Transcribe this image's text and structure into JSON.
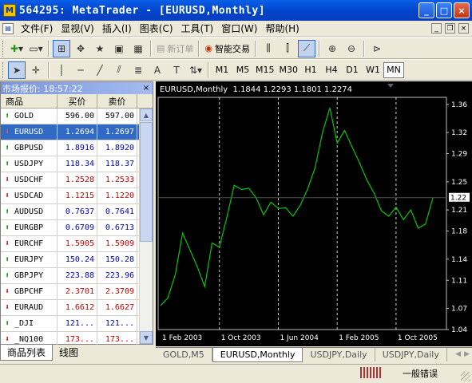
{
  "window": {
    "title": "564295: MetaTrader - [EURUSD,Monthly]"
  },
  "menu": {
    "items": [
      "文件(F)",
      "显视(V)",
      "插入(I)",
      "图表(C)",
      "工具(T)",
      "窗口(W)",
      "帮助(H)"
    ]
  },
  "toolbar": {
    "new_order_label": "新订单",
    "expert_label": "智能交易",
    "timeframes": [
      "M1",
      "M5",
      "M15",
      "M30",
      "H1",
      "H4",
      "D1",
      "W1",
      "MN"
    ],
    "active_timeframe": "MN"
  },
  "market_watch": {
    "header": "市场报价: 18:57:22",
    "columns": [
      "商品",
      "买价",
      "卖价"
    ],
    "rows": [
      {
        "symbol": "GOLD",
        "bid": "596.00",
        "ask": "597.00",
        "dir": "up",
        "color": "normal"
      },
      {
        "symbol": "EURUSD",
        "bid": "1.2694",
        "ask": "1.2697",
        "dir": "down",
        "color": "normal",
        "selected": true
      },
      {
        "symbol": "GBPUSD",
        "bid": "1.8916",
        "ask": "1.8920",
        "dir": "up",
        "color": "blue"
      },
      {
        "symbol": "USDJPY",
        "bid": "118.34",
        "ask": "118.37",
        "dir": "up",
        "color": "blue"
      },
      {
        "symbol": "USDCHF",
        "bid": "1.2528",
        "ask": "1.2533",
        "dir": "down",
        "color": "red"
      },
      {
        "symbol": "USDCAD",
        "bid": "1.1215",
        "ask": "1.1220",
        "dir": "down",
        "color": "red"
      },
      {
        "symbol": "AUDUSD",
        "bid": "0.7637",
        "ask": "0.7641",
        "dir": "up",
        "color": "blue"
      },
      {
        "symbol": "EURGBP",
        "bid": "0.6709",
        "ask": "0.6713",
        "dir": "up",
        "color": "blue"
      },
      {
        "symbol": "EURCHF",
        "bid": "1.5905",
        "ask": "1.5909",
        "dir": "down",
        "color": "red"
      },
      {
        "symbol": "EURJPY",
        "bid": "150.24",
        "ask": "150.28",
        "dir": "up",
        "color": "blue"
      },
      {
        "symbol": "GBPJPY",
        "bid": "223.88",
        "ask": "223.96",
        "dir": "up",
        "color": "blue"
      },
      {
        "symbol": "GBPCHF",
        "bid": "2.3701",
        "ask": "2.3709",
        "dir": "down",
        "color": "red"
      },
      {
        "symbol": "EURAUD",
        "bid": "1.6612",
        "ask": "1.6627",
        "dir": "down",
        "color": "red"
      },
      {
        "symbol": "_DJI",
        "bid": "121...",
        "ask": "121...",
        "dir": "up",
        "color": "blue"
      },
      {
        "symbol": "_NQ100",
        "bid": "173...",
        "ask": "173...",
        "dir": "down",
        "color": "red"
      }
    ],
    "tabs": [
      "商品列表",
      "线图"
    ]
  },
  "chart": {
    "header": "EURUSD,Monthly  1.1844 1.2293 1.1801 1.2274",
    "tabs": [
      "GOLD,M5",
      "EURUSD,Monthly",
      "USDJPY,Daily",
      "USDJPY,Daily"
    ],
    "active_tab": 1
  },
  "chart_data": {
    "type": "line",
    "title": "EURUSD,Monthly",
    "line_color": "#00c800",
    "y_ticks": [
      "1.36",
      "1.32",
      "1.29",
      "1.25",
      "1.21",
      "1.18",
      "1.14",
      "1.11",
      "1.07",
      "1.04"
    ],
    "y_tick_values": [
      1.36,
      1.32,
      1.29,
      1.25,
      1.21,
      1.18,
      1.14,
      1.11,
      1.07,
      1.04
    ],
    "ylim": [
      1.04,
      1.37
    ],
    "current_price": "1.22",
    "current_value": 1.2274,
    "x_ticks": [
      "1 Feb 2003",
      "1 Oct 2003",
      "1 Jun 2004",
      "1 Feb 2005",
      "1 Oct 2005"
    ],
    "x_tick_index": [
      0,
      8,
      16,
      24,
      32
    ],
    "values": [
      1.074,
      1.085,
      1.118,
      1.177,
      1.153,
      1.129,
      1.101,
      1.163,
      1.157,
      1.199,
      1.245,
      1.239,
      1.241,
      1.227,
      1.203,
      1.221,
      1.212,
      1.213,
      1.201,
      1.217,
      1.24,
      1.27,
      1.32,
      1.355,
      1.305,
      1.323,
      1.3,
      1.278,
      1.253,
      1.234,
      1.209,
      1.201,
      1.214,
      1.196,
      1.21,
      1.184,
      1.19,
      1.227
    ]
  },
  "status": {
    "text": "一般错误"
  }
}
